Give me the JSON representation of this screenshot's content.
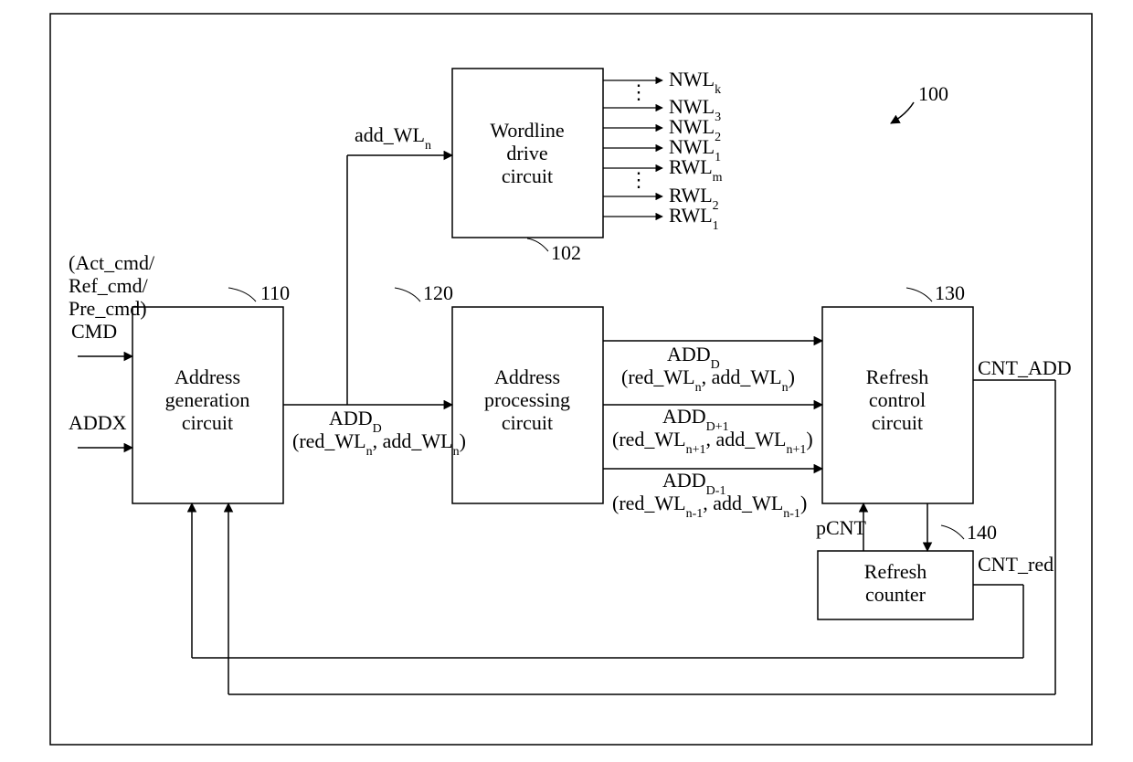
{
  "systemNumber": "100",
  "blocks": {
    "addrGen": {
      "num": "110",
      "line1": "Address",
      "line2": "generation",
      "line3": "circuit"
    },
    "addrProc": {
      "num": "120",
      "line1": "Address",
      "line2": "processing",
      "line3": "circuit"
    },
    "wordline": {
      "num": "102",
      "line1": "Wordline",
      "line2": "drive",
      "line3": "circuit"
    },
    "refreshCtrl": {
      "num": "130",
      "line1": "Refresh",
      "line2": "control",
      "line3": "circuit"
    },
    "refreshCnt": {
      "num": "140",
      "line1": "Refresh",
      "line2": "counter"
    }
  },
  "inputs": {
    "cmdParen1": "(Act_cmd/",
    "cmdParen2": "Ref_cmd/",
    "cmdParen3": "Pre_cmd)",
    "cmd": "CMD",
    "addx": "ADDX"
  },
  "signals": {
    "add_wln_top": "add_WL",
    "add_wln_top_sub": "n",
    "addd": "ADD",
    "addd_sub": "D",
    "addd_paren_open": "(red_WL",
    "addd_paren_mid": ", add_WL",
    "addd_sub_n": "n",
    "addd1": "ADD",
    "addd1_sub": "D+1",
    "addd1_sub_n": "n+1",
    "addd_1": "ADD",
    "addd_1_sub": "D-1",
    "addd_1_sub_n": "n-1",
    "cnt_add": "CNT_ADD",
    "cnt_red": "CNT_red",
    "pcnt": "pCNT"
  },
  "wordlines": {
    "nwl_k": "NWL",
    "nwl_k_sub": "k",
    "nwl_3": "NWL",
    "nwl_3_sub": "3",
    "nwl_2": "NWL",
    "nwl_2_sub": "2",
    "nwl_1": "NWL",
    "nwl_1_sub": "1",
    "rwl_m": "RWL",
    "rwl_m_sub": "m",
    "rwl_2": "RWL",
    "rwl_2_sub": "2",
    "rwl_1": "RWL",
    "rwl_1_sub": "1"
  }
}
